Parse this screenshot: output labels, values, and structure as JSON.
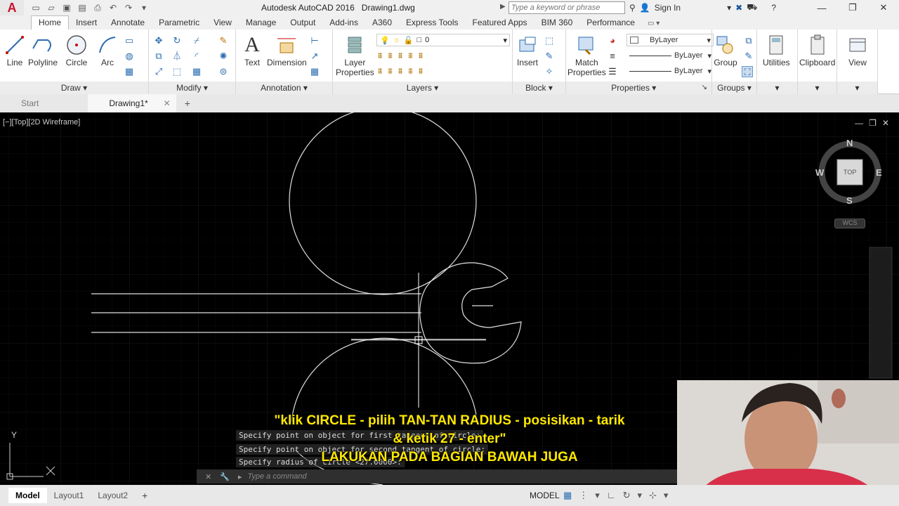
{
  "titlebar": {
    "app_name": "Autodesk AutoCAD 2016",
    "doc_name": "Drawing1.dwg",
    "search_placeholder": "Type a keyword or phrase",
    "sign_in": "Sign In"
  },
  "ribbon_tabs": [
    "Home",
    "Insert",
    "Annotate",
    "Parametric",
    "View",
    "Manage",
    "Output",
    "Add-ins",
    "A360",
    "Express Tools",
    "Featured Apps",
    "BIM 360",
    "Performance"
  ],
  "draw": {
    "line": "Line",
    "polyline": "Polyline",
    "circle": "Circle",
    "arc": "Arc",
    "title": "Draw"
  },
  "modify": {
    "title": "Modify"
  },
  "annotation": {
    "text": "Text",
    "dimension": "Dimension",
    "title": "Annotation"
  },
  "layers": {
    "layer_properties_1": "Layer",
    "layer_properties_2": "Properties",
    "current_layer": "0",
    "title": "Layers"
  },
  "block": {
    "insert": "Insert",
    "title": "Block"
  },
  "properties": {
    "match_1": "Match",
    "match_2": "Properties",
    "color": "ByLayer",
    "linetype": "ByLayer",
    "lineweight": "ByLayer",
    "title": "Properties"
  },
  "groups": {
    "group": "Group",
    "title": "Groups"
  },
  "utilities": {
    "label": "Utilities"
  },
  "clipboard": {
    "label": "Clipboard"
  },
  "view": {
    "label": "View"
  },
  "doc_tabs": {
    "start": "Start",
    "drawing": "Drawing1*"
  },
  "viewport": {
    "label": "[−][Top][2D Wireframe]",
    "viewcube": {
      "n": "N",
      "s": "S",
      "e": "E",
      "w": "W",
      "top": "TOP",
      "wcs": "WCS"
    },
    "ucs_y": "Y"
  },
  "command": {
    "history_1": "Specify point on object for first tangent of circle:",
    "history_2": "Specify point on object for second tangent of circle:",
    "history_3": "Specify radius of circle <27.0000>:",
    "placeholder": "Type a command"
  },
  "subtitles": {
    "line1": "\"klik CIRCLE - pilih TAN-TAN RADIUS - posisikan - tarik",
    "line2": "& ketik 27 - enter\"",
    "line3": "LAKUKAN PADA BAGIAN BAWAH JUGA"
  },
  "status": {
    "model_tab": "Model",
    "layout1": "Layout1",
    "layout2": "Layout2",
    "model_space": "MODEL"
  }
}
